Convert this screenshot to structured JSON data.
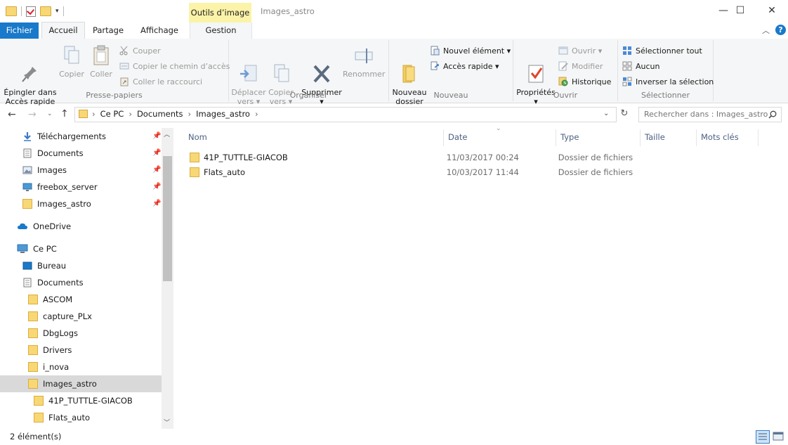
{
  "window": {
    "title": "Images_astro",
    "contextual_tab_group": "Outils d’image",
    "controls": {
      "minimize": "—",
      "maximize": "☐",
      "close": "✕"
    }
  },
  "quick_access_toolbar": {
    "dropdown": "▾"
  },
  "tabs": {
    "fichier": "Fichier",
    "accueil": "Accueil",
    "partage": "Partage",
    "affichage": "Affichage",
    "gestion": "Gestion"
  },
  "ribbon": {
    "presse_papiers": {
      "label": "Presse-papiers",
      "epingler": "Épingler dans\nAccès rapide",
      "copier": "Copier",
      "coller": "Coller",
      "couper": "Couper",
      "copier_chemin": "Copier le chemin d’accès",
      "coller_raccourci": "Coller le raccourci"
    },
    "organiser": {
      "label": "Organiser",
      "deplacer": "Déplacer\nvers ▾",
      "copier_vers": "Copier\nvers ▾",
      "supprimer": "Supprimer\n▾",
      "renommer": "Renommer"
    },
    "nouveau": {
      "label": "Nouveau",
      "nouveau_dossier": "Nouveau\ndossier",
      "nouvel_element": "Nouvel élément ▾",
      "acces_rapide": "Accès rapide ▾"
    },
    "ouvrir": {
      "label": "Ouvrir",
      "proprietes": "Propriétés\n▾",
      "ouvrir": "Ouvrir ▾",
      "modifier": "Modifier",
      "historique": "Historique"
    },
    "selectionner": {
      "label": "Sélectionner",
      "tout": "Sélectionner tout",
      "aucun": "Aucun",
      "inverser": "Inverser la sélection"
    }
  },
  "address_bar": {
    "breadcrumbs": [
      "Ce PC",
      "Documents",
      "Images_astro"
    ],
    "search_placeholder": "Rechercher dans : Images_astro"
  },
  "nav_pane": {
    "quick_access": [
      "Téléchargements",
      "Documents",
      "Images",
      "freebox_server",
      "Images_astro"
    ],
    "onedrive": "OneDrive",
    "ce_pc": "Ce PC",
    "ce_pc_items": [
      "Bureau",
      "Documents"
    ],
    "document_folders": [
      "ASCOM",
      "capture_PLx",
      "DbgLogs",
      "Drivers",
      "i_nova",
      "Images_astro"
    ],
    "images_astro_folders": [
      "41P_TUTTLE-GIACOB",
      "Flats_auto"
    ]
  },
  "file_list": {
    "columns": [
      "Nom",
      "Date",
      "Type",
      "Taille",
      "Mots clés"
    ],
    "rows": [
      {
        "name": "41P_TUTTLE-GIACOB",
        "date": "11/03/2017 00:24",
        "type": "Dossier de fichiers",
        "size": ""
      },
      {
        "name": "Flats_auto",
        "date": "10/03/2017 11:44",
        "type": "Dossier de fichiers",
        "size": ""
      }
    ]
  },
  "status_bar": {
    "count": "2 élément(s)"
  },
  "colors": {
    "accent": "#1979ca",
    "contextual": "#fbf3a8",
    "selection": "#d9d9d9",
    "folder": "#f8d775"
  }
}
